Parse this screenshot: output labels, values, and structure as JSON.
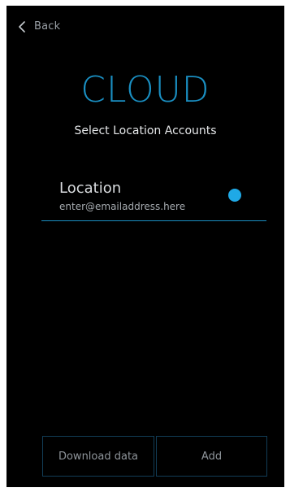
{
  "nav": {
    "back_label": "Back"
  },
  "header": {
    "title": "CLOUD",
    "subtitle": "Select Location Accounts"
  },
  "accounts": [
    {
      "name": "Location",
      "email": "enter@emailaddress.here",
      "status_color": "#1fa9e6"
    }
  ],
  "footer": {
    "download_label": "Download data",
    "add_label": "Add"
  },
  "colors": {
    "accent": "#1a8fc2",
    "background": "#000000"
  }
}
